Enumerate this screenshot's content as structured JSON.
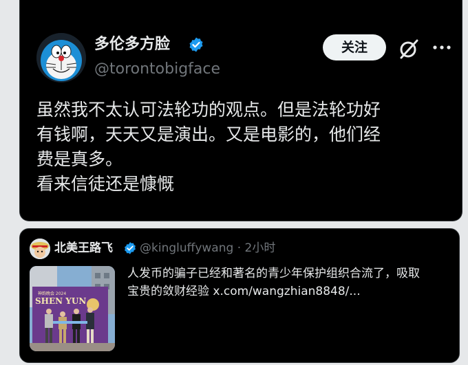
{
  "tweet": {
    "display_name": "多伦多方脸",
    "handle": "@torontobigface",
    "follow_label": "关注",
    "text_lines": [
      "虽然我不太认可法轮功的观点。但是法轮功好",
      "有钱啊，天天又是演出。又是电影的，他们经",
      "费是真多。",
      "看来信徒还是慷慨"
    ]
  },
  "quoted": {
    "display_name": "北美王路飞",
    "handle": "@kingluffywang",
    "separator": "·",
    "time": "2小时",
    "text_lines": [
      "人发币的骗子已经和著名的青少年保护组织合流了，吸取",
      "宝贵的敛财经验 "
    ],
    "link": "x.com/wangzhian8848/...",
    "image_texts": {
      "banner_small": "神韵晚会 2024",
      "banner_big": "SHEN YUN"
    }
  },
  "icons": {
    "verified": "verified-badge-icon",
    "grok": "grok-icon",
    "more": "more-icon"
  },
  "colors": {
    "background": "#000000",
    "text": "#e7e9ea",
    "secondary": "#71767b",
    "verified": "#1d9bf0",
    "border": "#2f3336"
  }
}
